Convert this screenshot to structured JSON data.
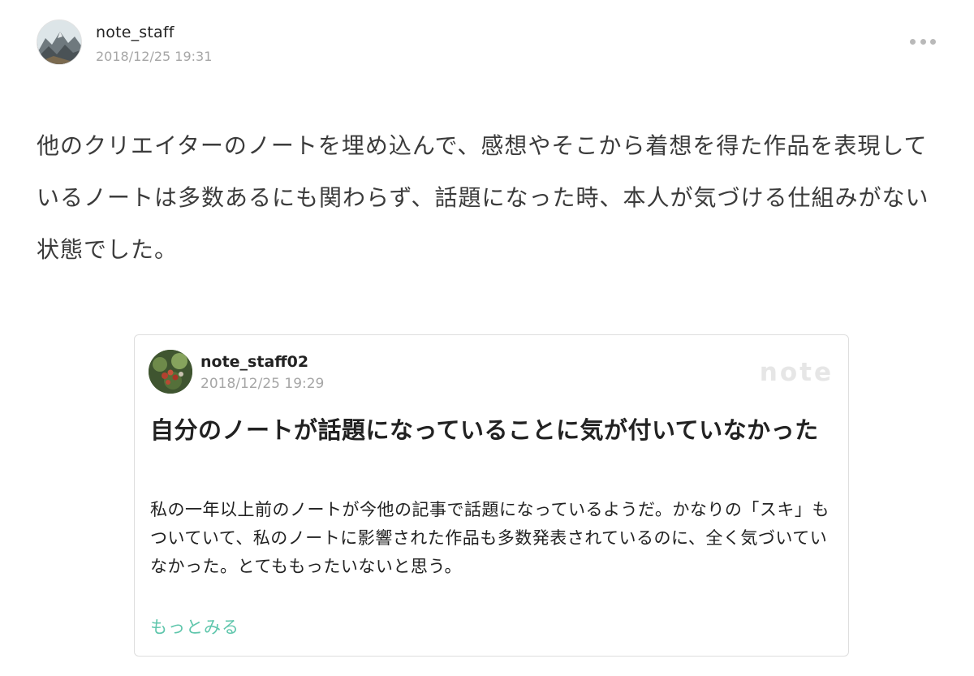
{
  "post": {
    "author": "note_staff",
    "date": "2018/12/25 19:31",
    "more_icon": "ellipsis-icon",
    "body": "他のクリエイターのノートを埋め込んで、感想やそこから着想を得た作品を表現しているノートは多数あるにも関わらず、話題になった時、本人が気づける仕組みがない状態でした。"
  },
  "embed": {
    "author": "note_staff02",
    "date": "2018/12/25 19:29",
    "logo": "note",
    "title": "自分のノートが話題になっていることに気が付いていなかった",
    "excerpt": "私の一年以上前のノートが今他の記事で話題になっているようだ。かなりの「スキ」もついていて、私のノートに影響された作品も多数発表されているのに、全く気づいていなかった。とてももったいないと思う。",
    "more_label": "もっとみる",
    "link_color": "#5fc6ac"
  }
}
